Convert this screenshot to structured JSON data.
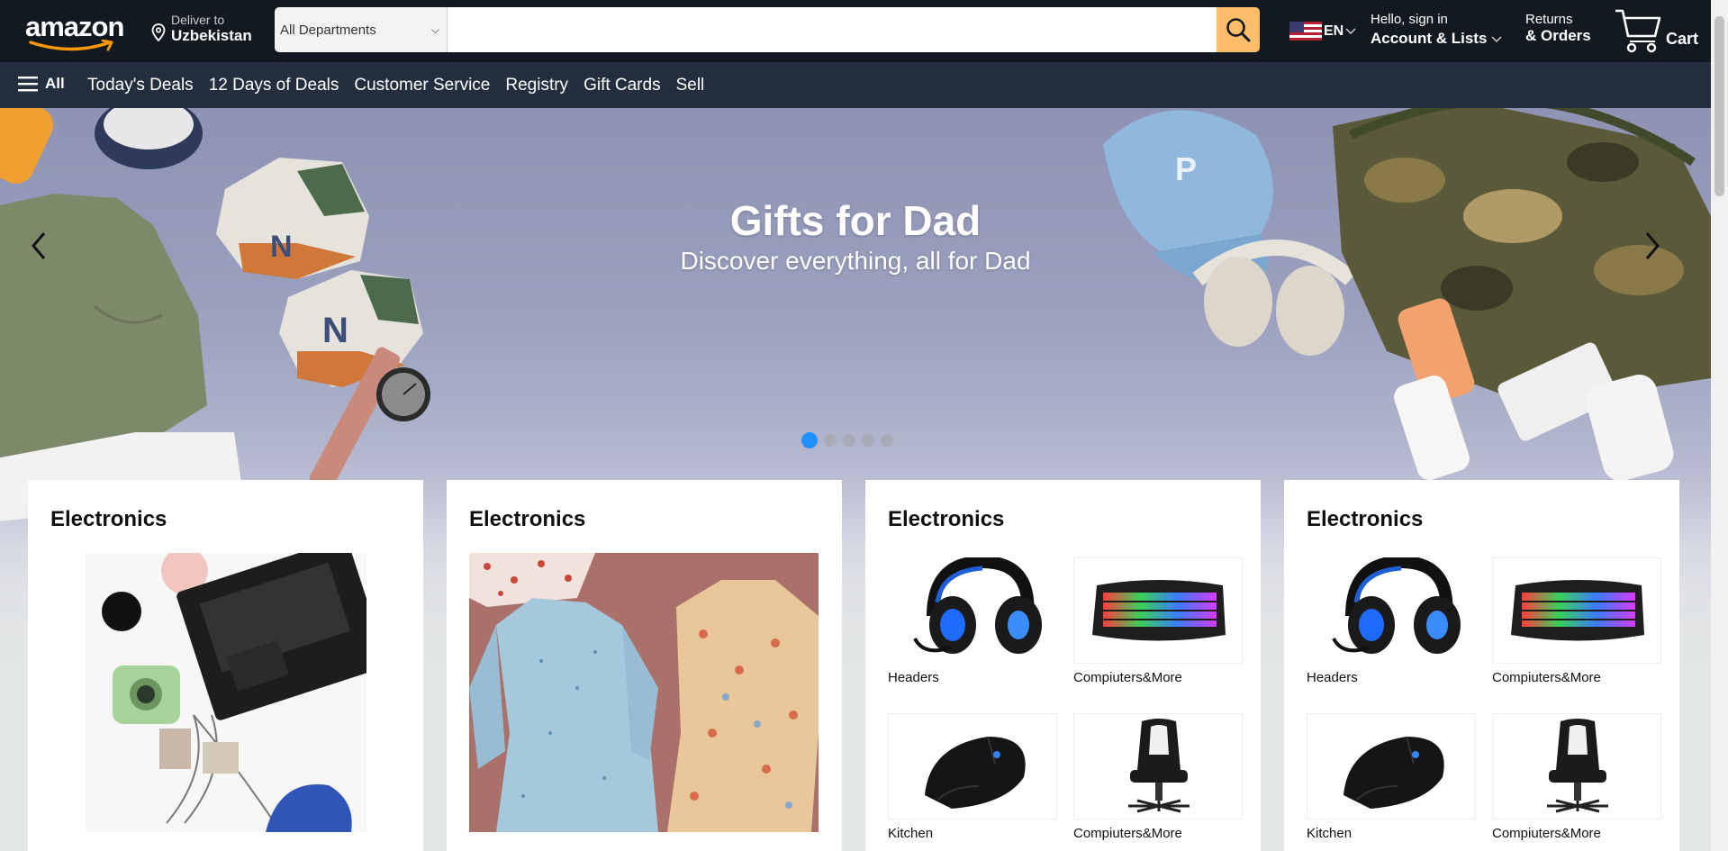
{
  "header": {
    "logo_text": "amazon",
    "deliver": {
      "line1": "Deliver to",
      "line2": "Uzbekistan"
    },
    "search": {
      "department": "All Departments",
      "placeholder": "",
      "value": ""
    },
    "language": "EN",
    "account": {
      "line1": "Hello, sign in",
      "line2": "Account & Lists"
    },
    "returns": {
      "line1": "Returns",
      "line2": "& Orders"
    },
    "cart": {
      "label": "Cart"
    }
  },
  "subnav": {
    "all_label": "All",
    "links": [
      "Today's Deals",
      "12 Days of Deals",
      "Customer Service",
      "Registry",
      "Gift Cards",
      "Sell"
    ]
  },
  "hero": {
    "title": "Gifts for Dad",
    "subtitle": "Discover everything, all for Dad",
    "slide_count": 5,
    "active_slide": 1
  },
  "cards": [
    {
      "title": "Electronics",
      "image": "electronics-desk-flatlay"
    },
    {
      "title": "Electronics",
      "image": "floral-dresses"
    },
    {
      "title": "Electronics",
      "items": [
        {
          "caption": "Headers",
          "image": "gaming-headset"
        },
        {
          "caption": "Compiuters&More",
          "image": "rgb-keyboard"
        },
        {
          "caption": "Kitchen",
          "image": "gaming-mouse"
        },
        {
          "caption": "Compiuters&More",
          "image": "gaming-chair"
        }
      ]
    },
    {
      "title": "Electronics",
      "items": [
        {
          "caption": "Headers",
          "image": "gaming-headset"
        },
        {
          "caption": "Compiuters&More",
          "image": "rgb-keyboard"
        },
        {
          "caption": "Kitchen",
          "image": "gaming-mouse"
        },
        {
          "caption": "Compiuters&More",
          "image": "gaming-chair"
        }
      ]
    }
  ],
  "colors": {
    "header_bg": "#131921",
    "subnav_bg": "#232f3e",
    "search_button": "#febd69",
    "active_dot": "#1e90ff"
  }
}
